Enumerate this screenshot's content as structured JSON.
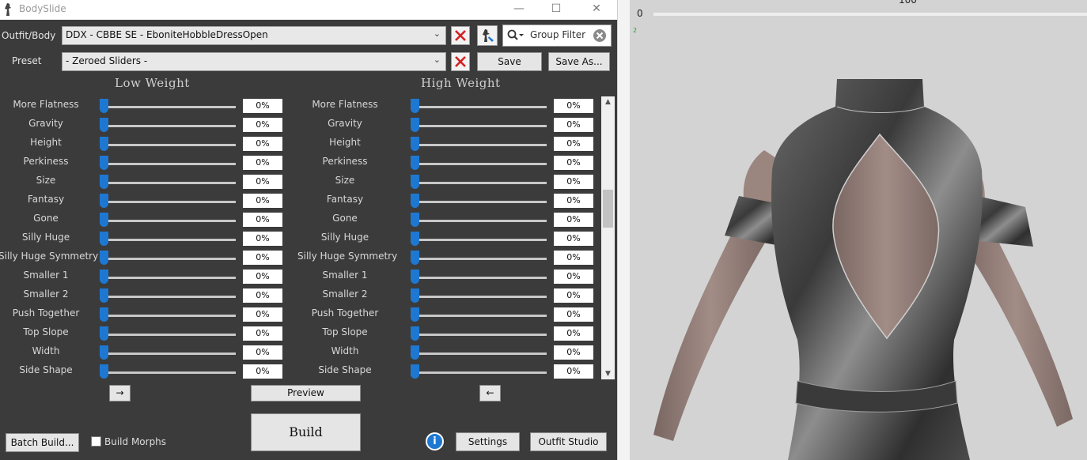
{
  "window": {
    "title": "BodySlide",
    "minimize": "—",
    "maximize": "☐",
    "close": "✕"
  },
  "outfit": {
    "label": "Outfit/Body",
    "value": "DDX - CBBE SE - EboniteHobbleDressOpen",
    "group_filter_placeholder": "Group Filter"
  },
  "preset": {
    "label": "Preset",
    "value": "- Zeroed Sliders -",
    "save": "Save",
    "save_as": "Save As..."
  },
  "columns": {
    "low": "Low Weight",
    "high": "High Weight"
  },
  "sliders": [
    {
      "name": "More Flatness",
      "low": "0%",
      "high": "0%"
    },
    {
      "name": "Gravity",
      "low": "0%",
      "high": "0%"
    },
    {
      "name": "Height",
      "low": "0%",
      "high": "0%"
    },
    {
      "name": "Perkiness",
      "low": "0%",
      "high": "0%"
    },
    {
      "name": "Size",
      "low": "0%",
      "high": "0%"
    },
    {
      "name": "Fantasy",
      "low": "0%",
      "high": "0%"
    },
    {
      "name": "Gone",
      "low": "0%",
      "high": "0%"
    },
    {
      "name": "Silly Huge",
      "low": "0%",
      "high": "0%"
    },
    {
      "name": "Silly Huge Symmetry",
      "low": "0%",
      "high": "0%"
    },
    {
      "name": "Smaller 1",
      "low": "0%",
      "high": "0%"
    },
    {
      "name": "Smaller 2",
      "low": "0%",
      "high": "0%"
    },
    {
      "name": "Push Together",
      "low": "0%",
      "high": "0%"
    },
    {
      "name": "Top Slope",
      "low": "0%",
      "high": "0%"
    },
    {
      "name": "Width",
      "low": "0%",
      "high": "0%"
    },
    {
      "name": "Side Shape",
      "low": "0%",
      "high": "0%"
    }
  ],
  "footer": {
    "copy_right": "→",
    "copy_left": "←",
    "preview": "Preview",
    "build": "Build",
    "batch_build": "Batch Build...",
    "build_morphs": "Build Morphs",
    "info": "i",
    "settings": "Settings",
    "outfit_studio": "Outfit Studio"
  },
  "preview_panel": {
    "weight_zero": "0",
    "weight_top": "100",
    "marker": "2"
  },
  "colors": {
    "accent": "#1e78d2",
    "window_bg": "#3b3b3b",
    "preview_bg": "#d3d3d3",
    "clear_x": "#d42020"
  },
  "icons": [
    "bodyslide-app-icon",
    "clear-x-icon",
    "outfit-studio-icon",
    "search-icon",
    "clear-filter-icon",
    "chevron-down-icon",
    "info-icon"
  ]
}
